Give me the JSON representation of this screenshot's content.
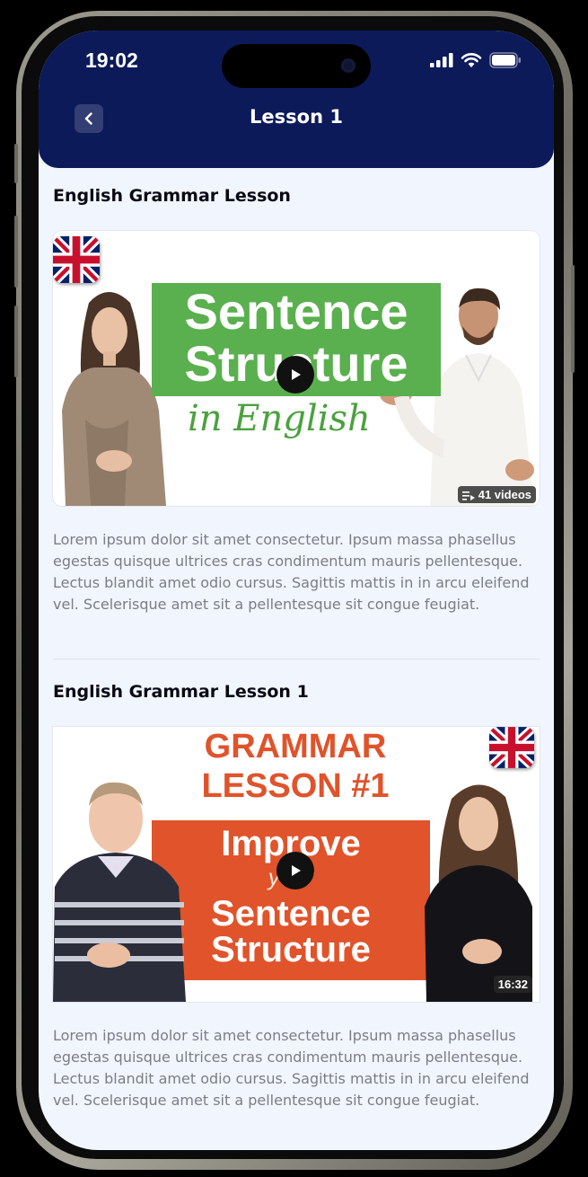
{
  "status_bar": {
    "time": "19:02"
  },
  "header": {
    "title": "Lesson 1"
  },
  "lessons": [
    {
      "title": "English Grammar Lesson",
      "thumbnail": {
        "line1": "Sentence",
        "line2": "Structure",
        "script": "in English",
        "badge": "41 videos"
      },
      "description": "Lorem ipsum dolor sit amet consectetur. Ipsum massa phasellus egestas quisque ultrices cras condimentum mauris pellentesque. Lectus blandit amet odio cursus. Sagittis mattis in in arcu eleifend vel. Scelerisque amet sit a pellentesque sit congue feugiat."
    },
    {
      "title": "English Grammar Lesson 1",
      "thumbnail": {
        "heading1": "GRAMMAR",
        "heading2": "LESSON #1",
        "line1": "Improve",
        "line2": "your",
        "line3": "Sentence",
        "line4": "Structure",
        "badge": "16:32"
      },
      "description": "Lorem ipsum dolor sit amet consectetur. Ipsum massa phasellus egestas quisque ultrices cras condimentum mauris pellentesque. Lectus blandit amet odio cursus. Sagittis mattis in in arcu eleifend vel. Scelerisque amet sit a pellentesque sit congue feugiat."
    }
  ],
  "colors": {
    "header_bg": "#0c1a5a",
    "screen_bg": "#f1f5fd",
    "accent_green": "#5ab04e",
    "accent_orange": "#e0532b"
  },
  "icons": [
    "back-chevron-icon",
    "signal-icon",
    "wifi-icon",
    "battery-icon",
    "play-icon",
    "playlist-icon",
    "uk-flag-icon"
  ]
}
